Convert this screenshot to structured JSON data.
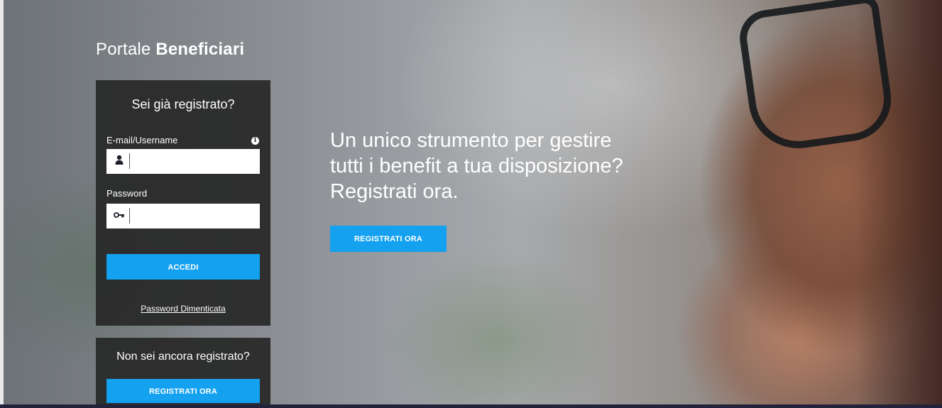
{
  "brand": {
    "light": "Portale",
    "bold": "Beneficiari"
  },
  "login": {
    "title": "Sei già registrato?",
    "username_label": "E-mail/Username",
    "username_value": "",
    "password_label": "Password",
    "password_value": "",
    "info_icon": "i",
    "submit_label": "ACCEDI",
    "forgot_label": "Password Dimenticata"
  },
  "register": {
    "title": "Non sei ancora registrato?",
    "button_label": "REGISTRATI ORA"
  },
  "hero": {
    "line1": "Un unico strumento per gestire",
    "line2": "tutti i benefit a tua disposizione?",
    "line3": "Registrati ora.",
    "button_label": "REGISTRATI ORA"
  },
  "colors": {
    "accent": "#13a1f0",
    "panel": "#282828"
  },
  "icons": {
    "user": "user-icon",
    "key": "key-icon",
    "info": "info-icon"
  }
}
